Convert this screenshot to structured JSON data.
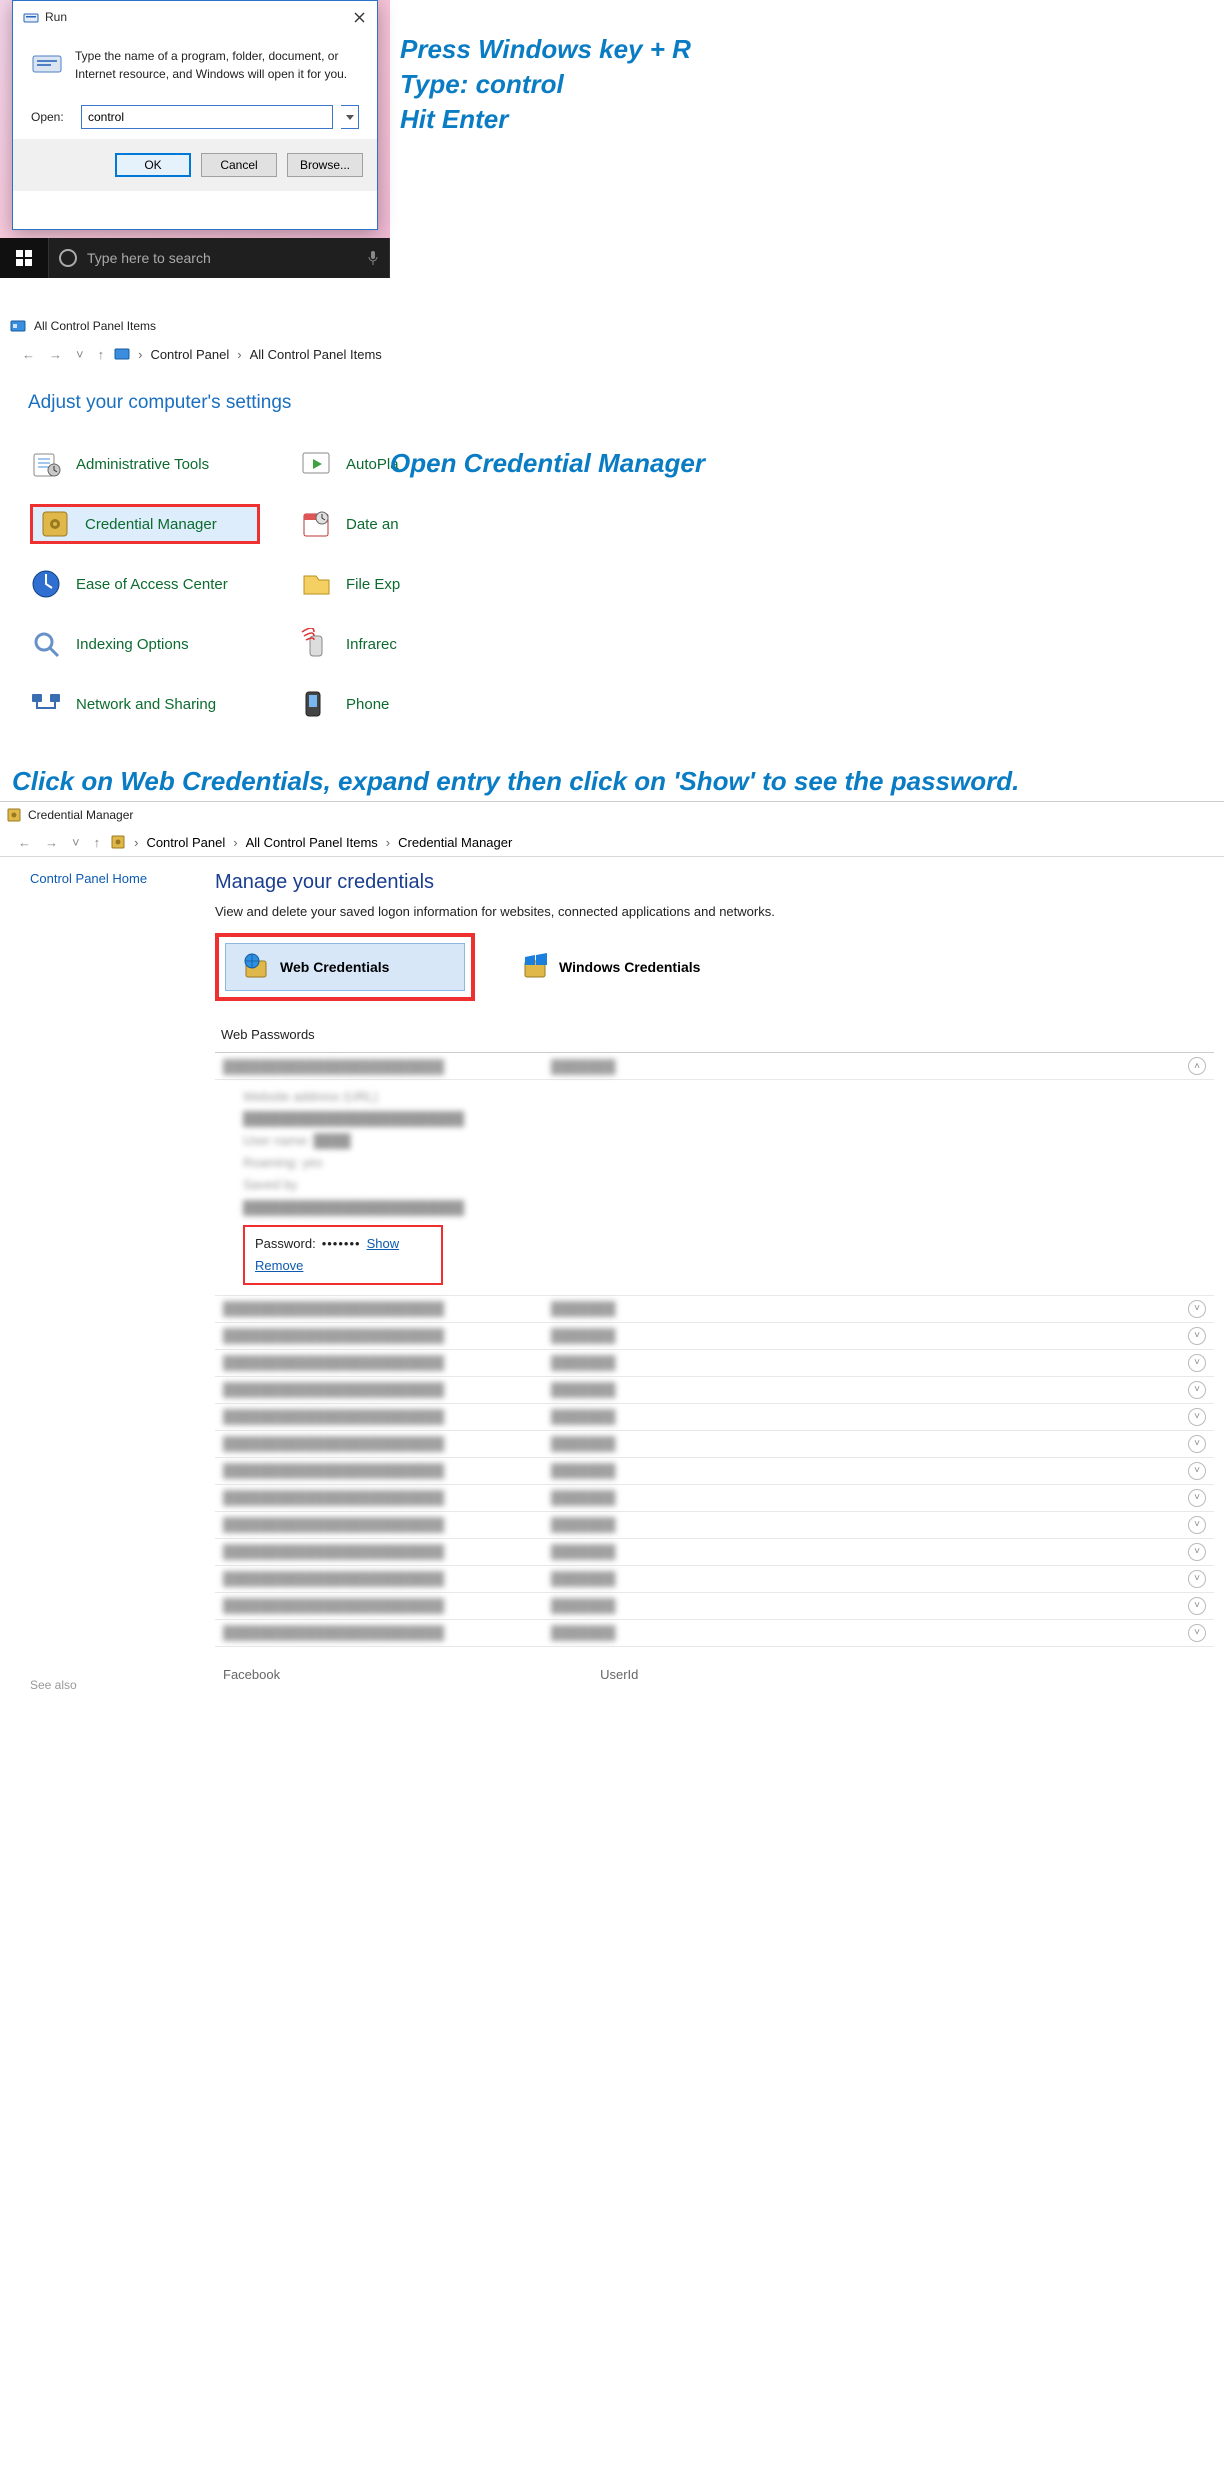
{
  "instructions": {
    "step1_line1": "Press Windows key + R",
    "step1_line2": "Type: control",
    "step1_line3": "Hit Enter",
    "step2": "Open Credential Manager",
    "step3": "Click on Web Credentials, expand entry then click on 'Show' to see the password."
  },
  "run_dialog": {
    "title": "Run",
    "body_text": "Type the name of a program, folder, document, or Internet resource, and Windows will open it for you.",
    "open_label": "Open:",
    "open_value": "control",
    "buttons": {
      "ok": "OK",
      "cancel": "Cancel",
      "browse": "Browse..."
    }
  },
  "taskbar": {
    "search_placeholder": "Type here to search"
  },
  "control_panel": {
    "window_title": "All Control Panel Items",
    "breadcrumb": {
      "root": "Control Panel",
      "leaf": "All Control Panel Items"
    },
    "heading": "Adjust your computer's settings",
    "items_col1": [
      "Administrative Tools",
      "Credential Manager",
      "Ease of Access Center",
      "Indexing Options",
      "Network and Sharing"
    ],
    "items_col2": [
      "AutoPla",
      "Date an",
      "File Exp",
      "Infrarec",
      "Phone"
    ],
    "highlight_index": 1
  },
  "cred_mgr": {
    "window_title": "Credential Manager",
    "breadcrumb": {
      "a": "Control Panel",
      "b": "All Control Panel Items",
      "c": "Credential Manager"
    },
    "home_link": "Control Panel Home",
    "heading": "Manage your credentials",
    "sub": "View and delete your saved logon information for websites, connected applications and networks.",
    "tab_web": "Web Credentials",
    "tab_win": "Windows Credentials",
    "wp_title": "Web Passwords",
    "expanded": {
      "password_label": "Password:",
      "password_mask": "•••••••",
      "show": "Show",
      "remove": "Remove"
    },
    "footer": {
      "col1": "Facebook",
      "col2": "UserId"
    },
    "see_also": "See also"
  }
}
